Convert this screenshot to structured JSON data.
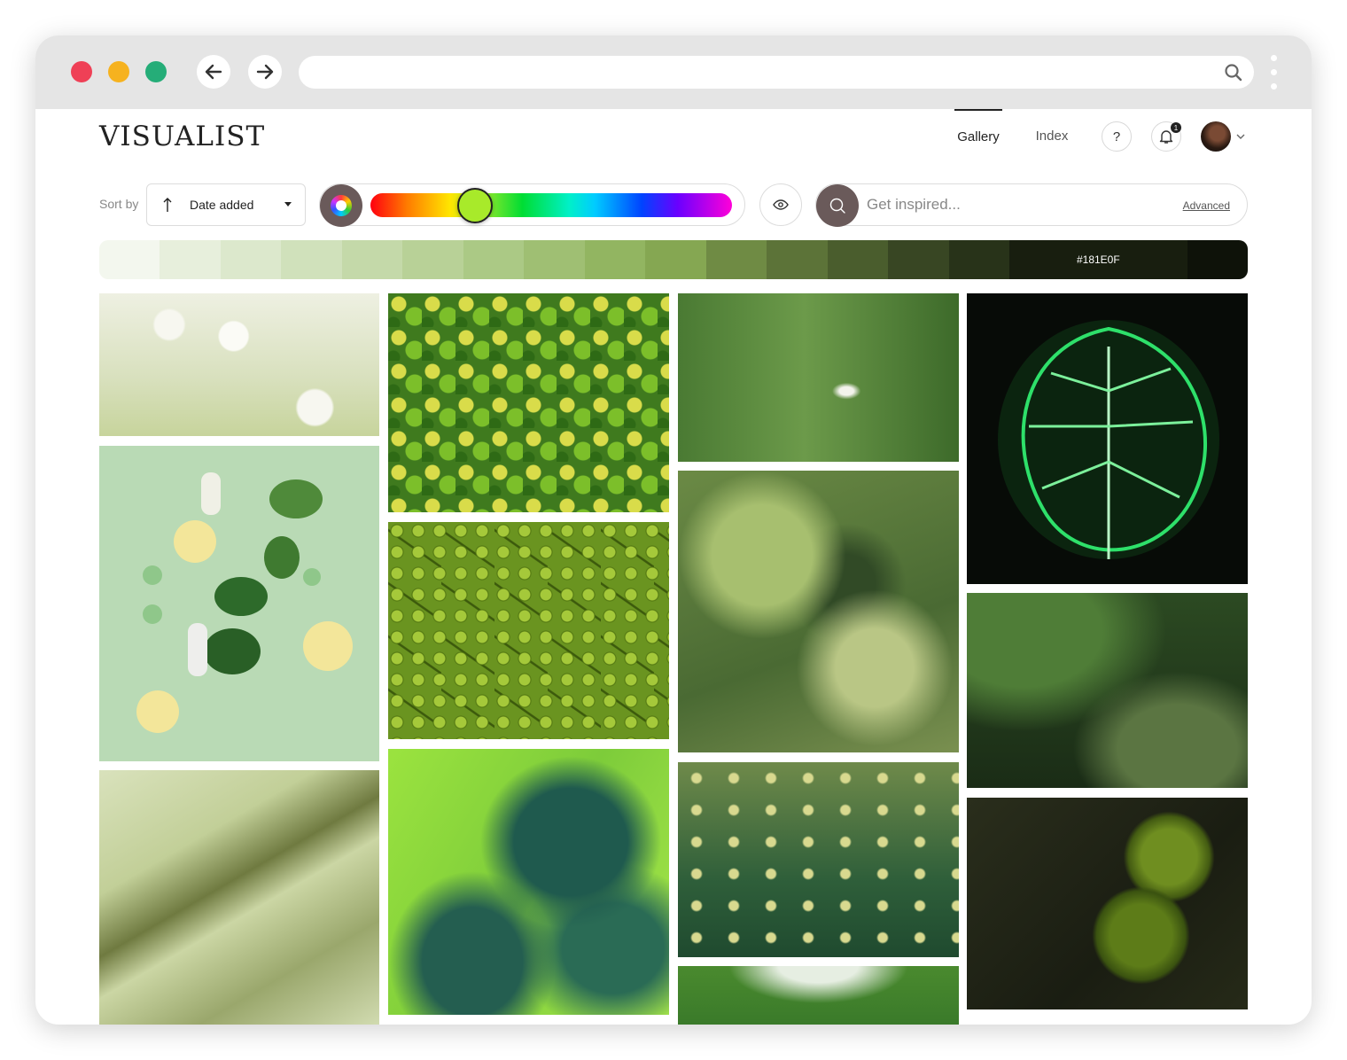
{
  "browser": {
    "url": "",
    "icons": {
      "back": "arrow-left-icon",
      "forward": "arrow-right-icon",
      "search": "search-icon",
      "menu": "kebab-menu-icon"
    }
  },
  "app": {
    "logo": "VISUALIST",
    "nav": [
      {
        "label": "Gallery",
        "active": true
      },
      {
        "label": "Index",
        "active": false
      }
    ],
    "help_label": "?",
    "notifications_count": "1"
  },
  "filters": {
    "sort_label": "Sort by",
    "sort_value": "Date added",
    "sort_direction": "ascending",
    "selected_hue_color": "#a8ea2a",
    "hue_position": 0.289,
    "search_placeholder": "Get inspired...",
    "advanced_label": "Advanced"
  },
  "palette": {
    "selected_hex": "#181E0F",
    "swatches": [
      "#f3f7ee",
      "#e7efdc",
      "#dce8cc",
      "#d0e1bb",
      "#c4d9a9",
      "#b8d197",
      "#abc985",
      "#9fbf73",
      "#92b561",
      "#85a752",
      "#6f8b44",
      "#5c7338",
      "#4a5d2d",
      "#384623",
      "#283319",
      "#181E0F",
      "#0e1209"
    ]
  },
  "gallery": [
    {
      "id": "white-wildflowers",
      "colors": [
        "#e9ecd9",
        "#c9d4a8",
        "#f5f5ee"
      ]
    },
    {
      "id": "green-limes-pile",
      "colors": [
        "#2f7a1a",
        "#b7c935",
        "#e4e050"
      ]
    },
    {
      "id": "daisy-in-grass",
      "colors": [
        "#3f6d2f",
        "#6f9a4c",
        "#2b4f22"
      ]
    },
    {
      "id": "neon-monstera-leaf",
      "colors": [
        "#0a0f0a",
        "#1ea74a",
        "#b4f5bf"
      ]
    },
    {
      "id": "vegetable-flatlay",
      "colors": [
        "#b8d9b2",
        "#2d6a2a",
        "#f2e59a"
      ]
    },
    {
      "id": "green-lego-bricks",
      "colors": [
        "#6f9a1e",
        "#a6c83a",
        "#3d5c10"
      ]
    },
    {
      "id": "rippling-water",
      "colors": [
        "#5e7c3a",
        "#a7bf6f",
        "#2f4524"
      ]
    },
    {
      "id": "mossy-forest",
      "colors": [
        "#1f3a1a",
        "#3d6a2c",
        "#6d8a52"
      ]
    },
    {
      "id": "green-liquid-texture",
      "colors": [
        "#cfd8ad",
        "#8a9a5a",
        "#4b5226"
      ]
    },
    {
      "id": "green-blue-paint-marble",
      "colors": [
        "#9be33f",
        "#1f5a4e",
        "#6bbd3a"
      ]
    },
    {
      "id": "dewy-grass-bokeh",
      "colors": [
        "#3d6a3a",
        "#b6c377",
        "#1d3f34"
      ]
    },
    {
      "id": "wet-limes-on-branch",
      "colors": [
        "#1b1f14",
        "#4f6b18",
        "#8aa62a"
      ]
    },
    {
      "id": "tree-canopy",
      "colors": [
        "#3a7a2a",
        "#aac98d",
        "#dfe9d8"
      ]
    }
  ]
}
